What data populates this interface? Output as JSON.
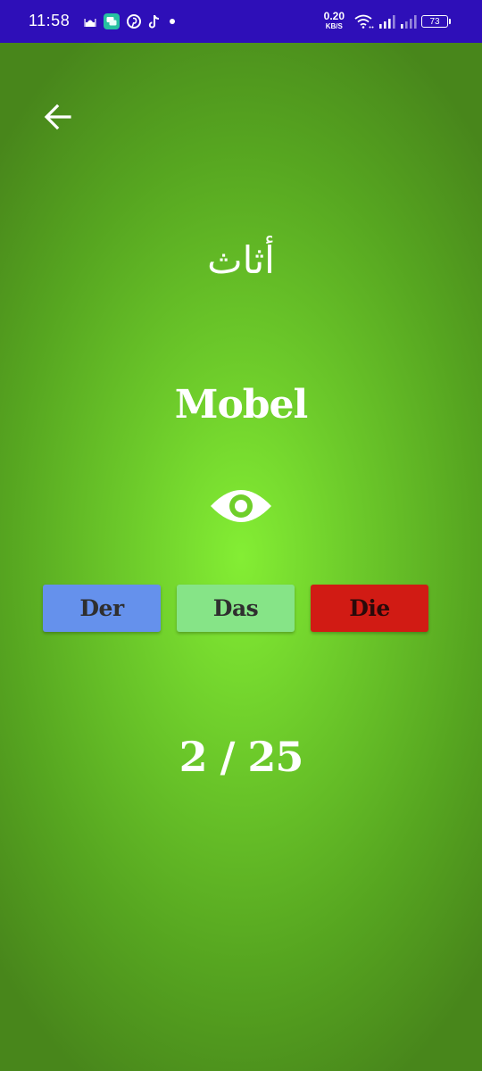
{
  "status_bar": {
    "time": "11:58",
    "net_speed_value": "0.20",
    "net_speed_unit": "KB/S",
    "battery": "73",
    "left_icons": [
      "mosque-icon",
      "chat-app-icon",
      "pinterest-icon",
      "tiktok-icon",
      "notification-dot-icon"
    ],
    "right_icons": [
      "wifi-icon",
      "signal-strong-icon",
      "signal-weak-icon",
      "battery-icon"
    ]
  },
  "colors": {
    "status_bar": "#2e0fb8",
    "background_center": "#84ee34",
    "background_edge": "#48861b",
    "der_button": "#6591ec",
    "das_button": "#86e487",
    "die_button": "#d11b14"
  },
  "card": {
    "arabic_word": "أثاث",
    "german_word": "Mobel",
    "reveal_icon": "eye-icon"
  },
  "articles": {
    "der": "Der",
    "das": "Das",
    "die": "Die"
  },
  "progress": {
    "text": "2 / 25",
    "current": 2,
    "total": 25
  }
}
